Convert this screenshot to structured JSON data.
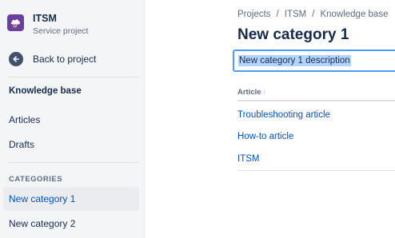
{
  "project": {
    "name": "ITSM",
    "type": "Service project",
    "avatar_color": "#6b3fa0"
  },
  "sidebar": {
    "back_label": "Back to project",
    "kb_heading": "Knowledge base",
    "items": [
      {
        "label": "Articles"
      },
      {
        "label": "Drafts"
      }
    ],
    "categories_heading": "CATEGORIES",
    "categories": [
      {
        "label": "New category 1",
        "active": true
      },
      {
        "label": "New category 2",
        "active": false
      }
    ]
  },
  "breadcrumb": [
    "Projects",
    "ITSM",
    "Knowledge base"
  ],
  "breadcrumb_separator": "/",
  "page": {
    "title": "New category 1",
    "description_value": "New category 1 description"
  },
  "table": {
    "column_header": "Article",
    "rows": [
      {
        "title": "Troubleshooting article"
      },
      {
        "title": "How-to article"
      },
      {
        "title": "ITSM"
      }
    ]
  },
  "colors": {
    "link": "#0052cc",
    "text": "#172b4d",
    "focus": "#4c9aff",
    "selection": "#b3d4ff"
  }
}
